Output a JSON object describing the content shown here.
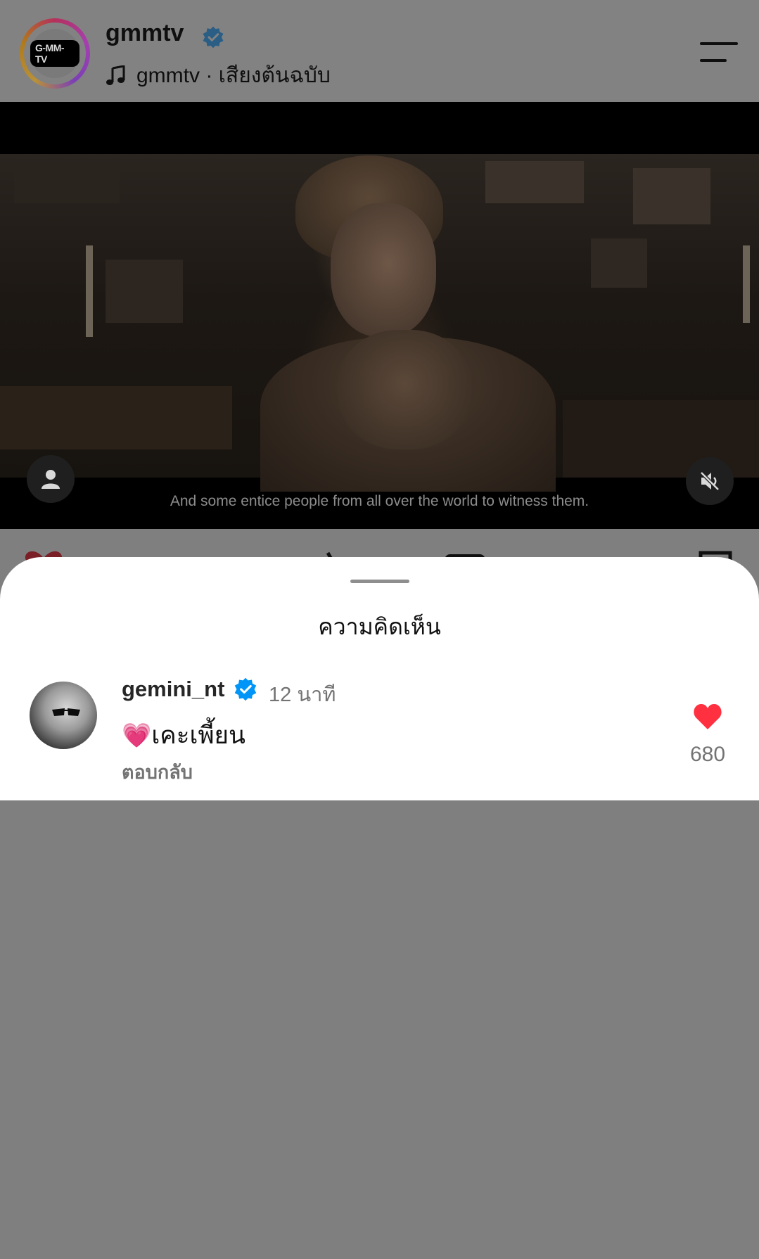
{
  "post_header": {
    "account_name": "gmmtv",
    "audio_label": "gmmtv · เสียงต้นฉบับ",
    "logo_text": "G-MM-TV"
  },
  "video": {
    "subtitle": "And some entice people from all over the world to witness them."
  },
  "comments_sheet": {
    "title": "ความคิดเห็น",
    "comments": [
      {
        "username": "gemini_nt",
        "time": "12 นาที",
        "text": "เคะเพี้ยน",
        "emoji": "💗",
        "reply_label": "ตอบกลับ",
        "likes": "680"
      }
    ]
  },
  "colors": {
    "verified": "#0095f6",
    "like": "#ff3040",
    "dim_overlay": "#7f7f7f"
  },
  "icons": [
    "verified-badge-icon",
    "music-note-icon",
    "menu-icon",
    "user-tag-icon",
    "mute-icon",
    "heart-icon"
  ]
}
